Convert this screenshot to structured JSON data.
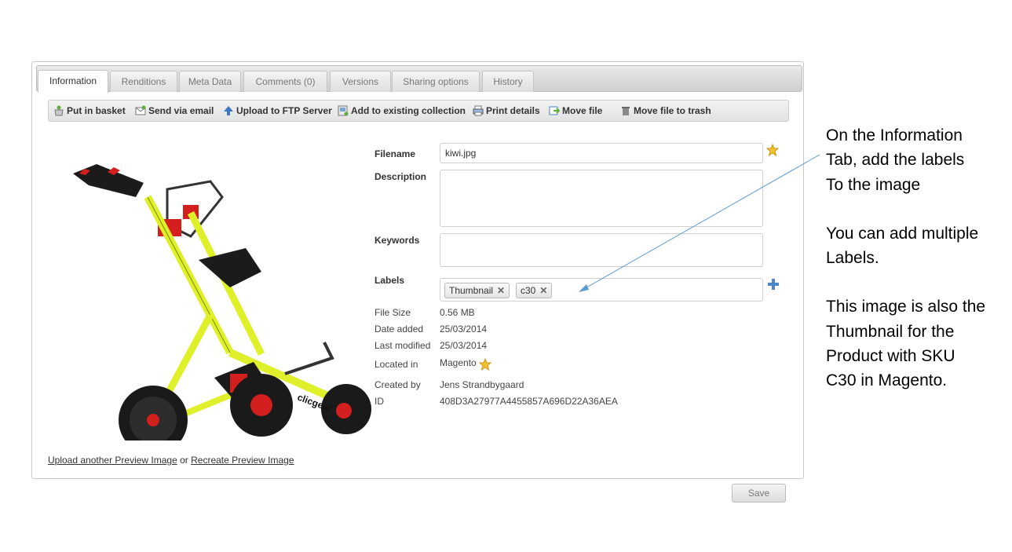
{
  "tabs": [
    "Information",
    "Renditions",
    "Meta Data",
    "Comments (0)",
    "Versions",
    "Sharing options",
    "History"
  ],
  "toolbar": {
    "put_in_basket": "Put in basket",
    "send_via_email": "Send via email",
    "upload_ftp": "Upload to FTP Server",
    "add_collection": "Add to existing collection",
    "print_details": "Print details",
    "move_file": "Move file",
    "move_to_trash": "Move file to trash"
  },
  "form": {
    "filename_label": "Filename",
    "filename_value": "kiwi.jpg",
    "description_label": "Description",
    "description_value": "",
    "keywords_label": "Keywords",
    "keywords_value": "",
    "labels_label": "Labels",
    "labels": [
      "Thumbnail",
      "c30"
    ]
  },
  "meta": {
    "file_size_label": "File Size",
    "file_size": "0.56 MB",
    "date_added_label": "Date added",
    "date_added": "25/03/2014",
    "last_modified_label": "Last modified",
    "last_modified": "25/03/2014",
    "located_in_label": "Located in",
    "located_in": "Magento",
    "created_by_label": "Created by",
    "created_by": "Jens Strandbygaard",
    "id_label": "ID",
    "id": "408D3A27977A4455857A696D22A36AEA"
  },
  "preview": {
    "upload_link": "Upload another Preview Image",
    "or_text": "or",
    "recreate_link": "Recreate Preview Image",
    "brand_text": "clicgear"
  },
  "save_label": "Save",
  "annotation": {
    "p1": [
      "On the Information",
      "Tab, add the labels",
      "To the image"
    ],
    "p2": [
      "You can add multiple",
      "Labels."
    ],
    "p3": [
      "This image is also the",
      "Thumbnail for the",
      "Product with SKU",
      "C30 in Magento."
    ]
  },
  "colors": {
    "arrow": "#5b9bd5",
    "star": "#f2c230",
    "plus": "#4a86c8",
    "cart_frame": "#dff02a"
  }
}
